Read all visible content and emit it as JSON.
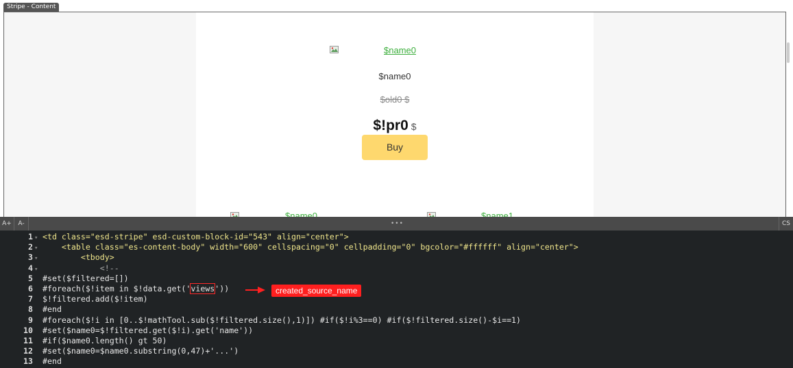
{
  "preview": {
    "tab_label": "Stripe - Content",
    "top_link": "$name0",
    "product_name": "$name0",
    "old_price": "$old0 $",
    "price_main": "$!pr0",
    "price_currency": "$",
    "buy_label": "Buy",
    "bottom_links": [
      "$name0",
      "$name1"
    ]
  },
  "toolbar": {
    "increase_font": "A+",
    "decrease_font": "A-",
    "dots": "•••",
    "css_tab": "CS"
  },
  "editor": {
    "line_numbers": [
      "1",
      "2",
      "3",
      "4",
      "5",
      "6",
      "7",
      "8",
      "9",
      "10",
      "11",
      "12",
      "13"
    ],
    "lines": [
      "<td class=\"esd-stripe\" esd-custom-block-id=\"543\" align=\"center\">",
      "    <table class=\"es-content-body\" width=\"600\" cellspacing=\"0\" cellpadding=\"0\" bgcolor=\"#ffffff\" align=\"center\">",
      "        <tbody>",
      "            <!--",
      "#set($filtered=[])",
      "#foreach($!item in $!data.get('views'))",
      "$!filtered.add($!item)",
      "#end",
      "#foreach($!i in [0..$!mathTool.sub($!filtered.size(),1)]) #if($!i%3==0) #if($!filtered.size()-$i==1)",
      "#set($name0=$!filtered.get($!i).get('name'))",
      "#if($name0.length() gt 50)",
      "#set($name0=$name0.substring(0,47)+'...')",
      "#end"
    ],
    "callout": "created_source_name",
    "highlight_word": "views"
  },
  "colors": {
    "link_green": "#3cae3c",
    "buy_button": "#fed86e",
    "editor_bg": "#202325",
    "callout_red": "#ff1f1f"
  }
}
